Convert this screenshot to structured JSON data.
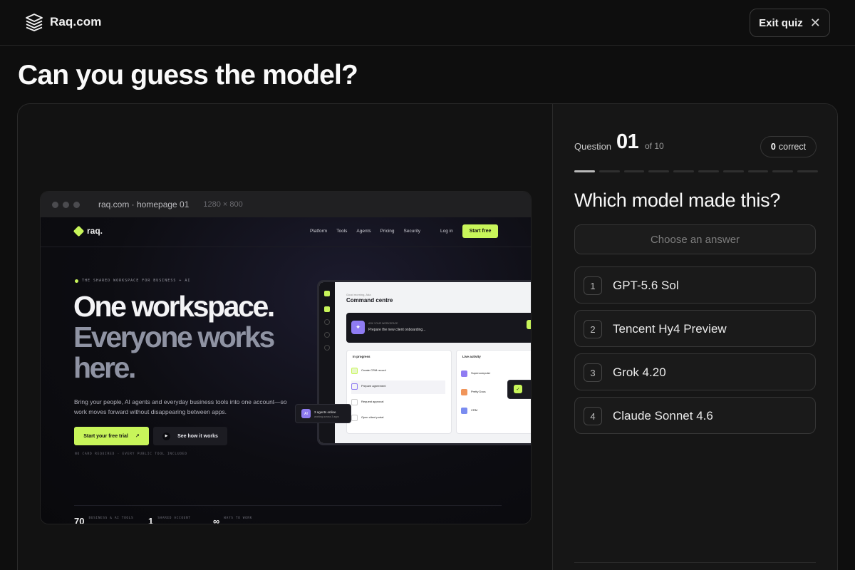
{
  "app": {
    "brand": "Raq.com",
    "exit_label": "Exit quiz",
    "page_title": "Can you guess the model?"
  },
  "preview": {
    "url": "raq.com · homepage 01",
    "dimensions": "1280 × 800",
    "site": {
      "logo": "raq.",
      "nav": [
        "Platform",
        "Tools",
        "Agents",
        "Pricing",
        "Security"
      ],
      "login": "Log in",
      "cta": "Start free",
      "eyebrow": "THE SHARED WORKSPACE FOR BUSINESS + AI",
      "headline_1": "One workspace.",
      "headline_2": "Everyone works",
      "headline_3": "here.",
      "body": "Bring your people, AI agents and everyday business tools into one account—so work moves forward without disappearing between apps.",
      "primary_cta": "Start your free trial",
      "secondary_cta": "See how it works",
      "fine_print": "NO CARD REQUIRED   ·   EVERY PUBLIC TOOL INCLUDED",
      "stats": [
        {
          "value": "70",
          "label": "BUSINESS & AI TOOLS"
        },
        {
          "value": "1",
          "label": "SHARED ACCOUNT"
        },
        {
          "value": "∞",
          "label": "WAYS TO WORK"
        }
      ],
      "dashboard": {
        "small_label": "Good morning, Ada",
        "title": "Command centre",
        "hero_label": "ASK YOUR WORKSPACE",
        "hero_text": "Prepare the new client onboarding...",
        "panel_left_title": "In progress",
        "panel_left_rows": [
          "Create CRM record",
          "Prepare agreement",
          "Request approval",
          "Open client portal"
        ],
        "panel_right_title": "Live activity",
        "panel_right_rows": [
          "Supercomputer",
          "Pretty Docs",
          "CRM"
        ],
        "agents_online": "3 agents online",
        "agents_sub": "working across 3 apps"
      }
    }
  },
  "quiz": {
    "question_label": "Question",
    "question_number": "01",
    "question_total": "of 10",
    "correct_count": "0",
    "correct_label": "correct",
    "progress": {
      "current": 1,
      "total": 10
    },
    "prompt": "Which model made this?",
    "choose_placeholder": "Choose an answer",
    "options": [
      {
        "key": "1",
        "label": "GPT-5.6 Sol"
      },
      {
        "key": "2",
        "label": "Tencent Hy4 Preview"
      },
      {
        "key": "3",
        "label": "Grok 4.20"
      },
      {
        "key": "4",
        "label": "Claude Sonnet 4.6"
      }
    ]
  },
  "colors": {
    "background": "#0e0e0e",
    "accent_lime": "#c8f55a",
    "accent_violet": "#8f7cf2"
  },
  "icons": {
    "brand": "stacked-layers-icon",
    "exit": "close-icon"
  }
}
